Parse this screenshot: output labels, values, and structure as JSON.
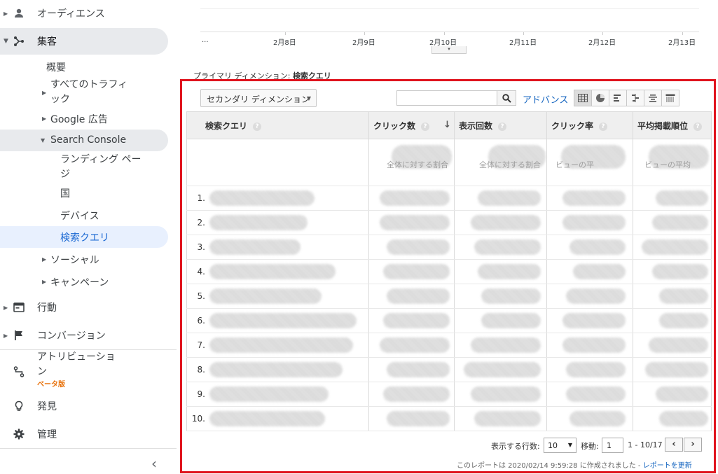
{
  "sidebar": {
    "audience": "オーディエンス",
    "acquisition": "集客",
    "overview": "概要",
    "all_traffic_line1": "すべてのトラフィ",
    "all_traffic_line2": "ック",
    "google_ads": "Google 広告",
    "search_console": "Search Console",
    "landing_line1": "ランディング ペー",
    "landing_line2": "ジ",
    "country": "国",
    "device": "デバイス",
    "queries": "検索クエリ",
    "social": "ソーシャル",
    "campaigns": "キャンペーン",
    "behavior": "行動",
    "conversions": "コンバージョン",
    "attribution_line1": "アトリビューショ",
    "attribution_line2": "ン",
    "beta": "ベータ版",
    "discover": "発見",
    "admin": "管理",
    "collapse": "‹"
  },
  "chart": {
    "x_ticks": [
      "...",
      "2月8日",
      "2月9日",
      "2月10日",
      "2月11日",
      "2月12日",
      "2月13日"
    ]
  },
  "primary_dimension": {
    "label": "プライマリ ディメンション:",
    "value": "検索クエリ"
  },
  "toolbar": {
    "secondary_dimension": "セカンダリ ディメンション",
    "search_value": "",
    "advanced": "アドバンス"
  },
  "table": {
    "headers": {
      "query": "検索クエリ",
      "clicks": "クリック数",
      "impressions": "表示回数",
      "ctr": "クリック率",
      "position": "平均掲載順位"
    },
    "summary": {
      "clicks": "全体に対する割合",
      "impressions": "全体に対する割合",
      "ctr": "ビューの平",
      "position": "ビューの平均"
    },
    "row_numbers": [
      "1.",
      "2.",
      "3.",
      "4.",
      "5.",
      "6.",
      "7.",
      "8.",
      "9.",
      "10."
    ]
  },
  "pagination": {
    "rows_label": "表示する行数:",
    "rows_value": "10",
    "goto_label": "移動:",
    "goto_value": "1",
    "range": "1 - 10/17",
    "prev": "‹",
    "next": "›"
  },
  "footer": {
    "text": "このレポートは 2020/02/14 9:59:28 に作成されました -",
    "refresh": "レポートを更新"
  }
}
